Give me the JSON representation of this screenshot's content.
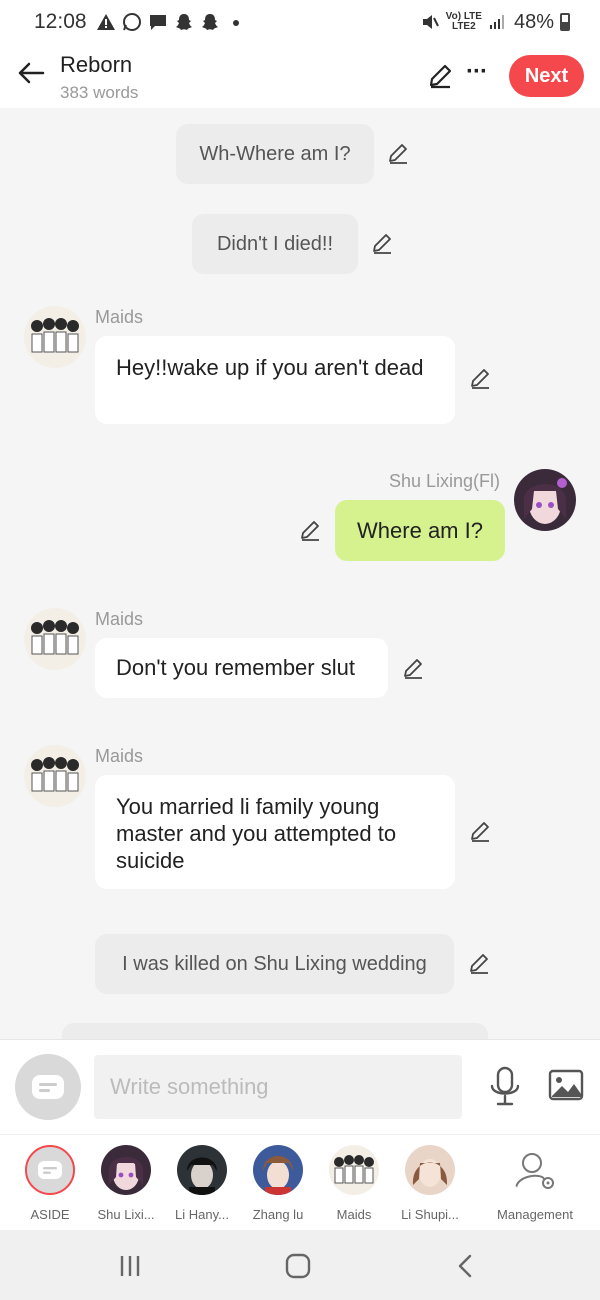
{
  "status_bar": {
    "time": "12:08",
    "network_top": "Vo) LTE",
    "network_bottom": "LTE2",
    "battery": "48%"
  },
  "header": {
    "title": "Reborn",
    "word_count": "383 words",
    "next_label": "Next"
  },
  "messages": [
    {
      "type": "aside",
      "text": "Wh-Where am I?"
    },
    {
      "type": "aside",
      "text": "Didn't I died!!"
    },
    {
      "type": "left",
      "speaker": "Maids",
      "text": "Hey!!wake up if you aren't dead"
    },
    {
      "type": "right",
      "speaker": "Shu Lixing(Fl)",
      "text": "Where am I?"
    },
    {
      "type": "left",
      "speaker": "Maids",
      "text": "Don't you remember slut"
    },
    {
      "type": "left",
      "speaker": "Maids",
      "text": "You married li family young master and you attempted to suicide"
    },
    {
      "type": "aside",
      "text": "I was killed on Shu Lixing wedding"
    }
  ],
  "input": {
    "placeholder": "Write something"
  },
  "characters": [
    {
      "label": "ASIDE"
    },
    {
      "label": "Shu Lixi..."
    },
    {
      "label": "Li Hany..."
    },
    {
      "label": "Zhang lu"
    },
    {
      "label": "Maids"
    },
    {
      "label": "Li Shupi..."
    },
    {
      "label": "Management"
    }
  ],
  "colors": {
    "accent": "#f5484d",
    "right_bubble": "#d5f28f",
    "aside_bubble": "#ececec"
  }
}
